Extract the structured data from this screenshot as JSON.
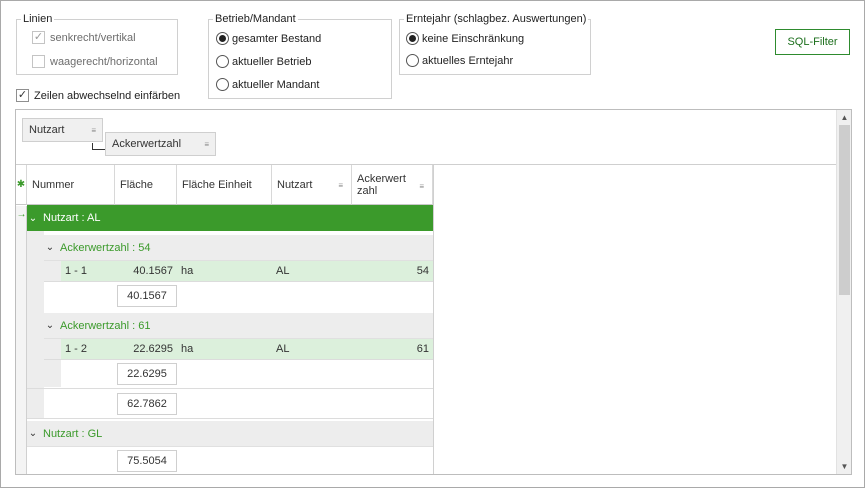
{
  "linien": {
    "title": "Linien",
    "vertical_label": "senkrecht/vertikal",
    "vertical_checked": true,
    "horizontal_label": "waagerecht/horizontal",
    "horizontal_checked": false
  },
  "betrieb": {
    "title": "Betrieb/Mandant",
    "options": [
      "gesamter Bestand",
      "aktueller Betrieb",
      "aktueller Mandant"
    ],
    "selected": 0
  },
  "erntejahr": {
    "title": "Erntejahr (schlagbez. Auswertungen)",
    "options": [
      "keine Einschränkung",
      "aktuelles Erntejahr"
    ],
    "selected": 0
  },
  "zeilen": {
    "label": "Zeilen abwechselnd einfärben",
    "checked": true
  },
  "sql_filter_label": "SQL-Filter",
  "grouping": {
    "chips": [
      "Nutzart",
      "Ackerwertzahl"
    ]
  },
  "grid": {
    "columns": [
      "Nummer",
      "Fläche",
      "Fläche Einheit",
      "Nutzart",
      "Ackerwert zahl"
    ],
    "groups": [
      {
        "label": "Nutzart : AL",
        "subgroups": [
          {
            "label": "Ackerwertzahl : 54",
            "rows": [
              {
                "nummer": "1 - 1",
                "flaeche": "40.1567",
                "einheit": "ha",
                "nutzart": "AL",
                "ackerwertzahl": "54"
              }
            ],
            "sum": "40.1567"
          },
          {
            "label": "Ackerwertzahl : 61",
            "rows": [
              {
                "nummer": "1 - 2",
                "flaeche": "22.6295",
                "einheit": "ha",
                "nutzart": "AL",
                "ackerwertzahl": "61"
              }
            ],
            "sum": "22.6295"
          }
        ],
        "sum": "62.7862"
      },
      {
        "label": "Nutzart : GL",
        "sum": "75.5054"
      }
    ]
  }
}
